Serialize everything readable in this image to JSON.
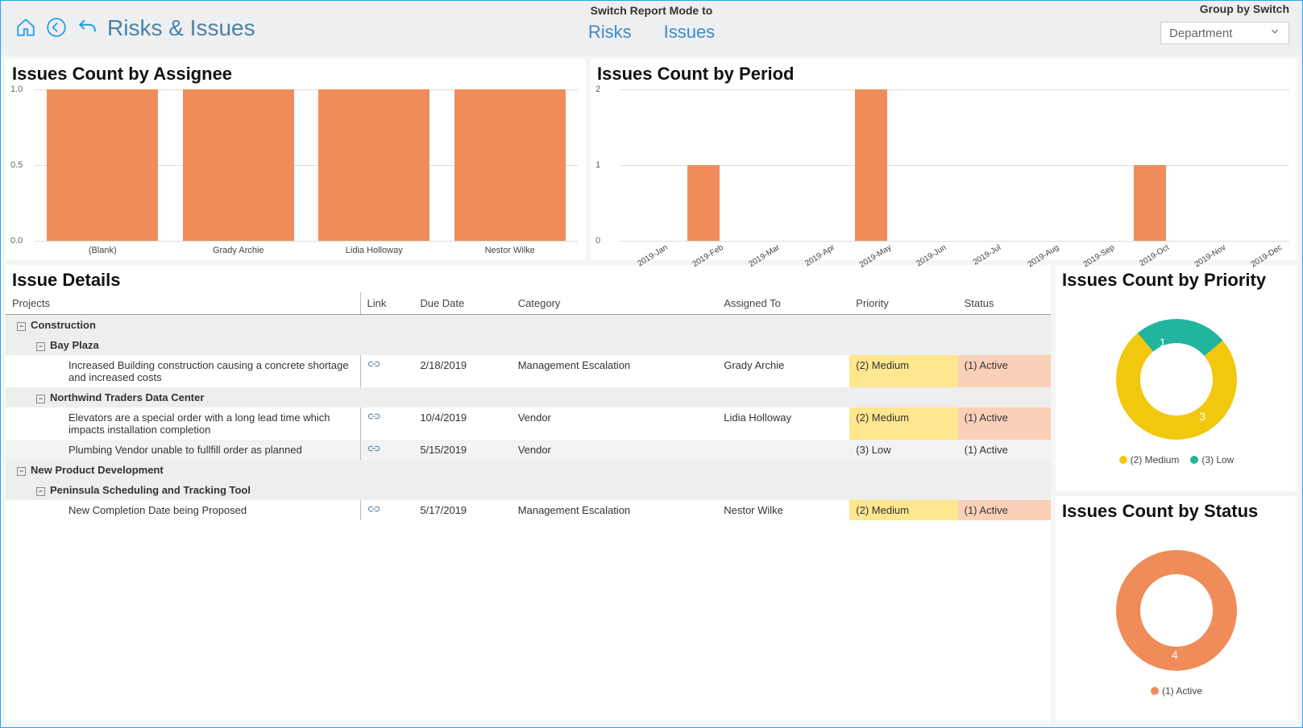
{
  "header": {
    "page_title": "Risks & Issues",
    "mode_label": "Switch Report Mode to",
    "tabs": [
      "Risks",
      "Issues"
    ],
    "groupby_label": "Group by Switch",
    "groupby_value": "Department"
  },
  "panel_assignee_title": "Issues Count by Assignee",
  "panel_period_title": "Issues Count by Period",
  "panel_details_title": "Issue Details",
  "panel_priority_title": "Issues Count by Priority",
  "panel_status_title": "Issues Count by Status",
  "details": {
    "columns": [
      "Projects",
      "Link",
      "Due Date",
      "Category",
      "Assigned To",
      "Priority",
      "Status"
    ],
    "groups": [
      {
        "name": "Construction",
        "subgroups": [
          {
            "name": "Bay Plaza",
            "rows": [
              {
                "desc": "Increased Building construction causing a concrete shortage and increased costs",
                "due": "2/18/2019",
                "category": "Management Escalation",
                "assigned": "Grady Archie",
                "priority": "(2) Medium",
                "priority_class": "medium",
                "status": "(1) Active"
              }
            ]
          },
          {
            "name": "Northwind Traders Data Center",
            "rows": [
              {
                "desc": "Elevators are a special order with a long lead time which impacts installation completion",
                "due": "10/4/2019",
                "category": "Vendor",
                "assigned": "Lidia Holloway",
                "priority": "(2) Medium",
                "priority_class": "medium",
                "status": "(1) Active"
              },
              {
                "desc": "Plumbing Vendor unable to fullfill order as planned",
                "due": "5/15/2019",
                "category": "Vendor",
                "assigned": "",
                "priority": "(3) Low",
                "priority_class": "low",
                "status": "(1) Active",
                "alt": true
              }
            ]
          }
        ]
      },
      {
        "name": "New Product Development",
        "subgroups": [
          {
            "name": "Peninsula Scheduling and Tracking Tool",
            "rows": [
              {
                "desc": "New Completion Date being Proposed",
                "due": "5/17/2019",
                "category": "Management Escalation",
                "assigned": "Nestor Wilke",
                "priority": "(2) Medium",
                "priority_class": "medium",
                "status": "(1) Active"
              }
            ]
          }
        ]
      }
    ]
  },
  "priority_legend": [
    "(2) Medium",
    "(3) Low"
  ],
  "priority_colors": [
    "#f2c80f",
    "#21b5a0"
  ],
  "priority_values": [
    3,
    1
  ],
  "status_legend": [
    "(1) Active"
  ],
  "status_colors": [
    "#f08c5a"
  ],
  "status_values": [
    4
  ],
  "chart_data": [
    {
      "type": "bar",
      "title": "Issues Count by Assignee",
      "categories": [
        "(Blank)",
        "Grady Archie",
        "Lidia Holloway",
        "Nestor Wilke"
      ],
      "values": [
        1,
        1,
        1,
        1
      ],
      "ylim": [
        0,
        1
      ],
      "yticks": [
        0.0,
        0.5,
        1.0
      ]
    },
    {
      "type": "bar",
      "title": "Issues Count by Period",
      "categories": [
        "2019-Jan",
        "2019-Feb",
        "2019-Mar",
        "2019-Apr",
        "2019-May",
        "2019-Jun",
        "2019-Jul",
        "2019-Aug",
        "2019-Sep",
        "2019-Oct",
        "2019-Nov",
        "2019-Dec"
      ],
      "values": [
        0,
        1,
        0,
        0,
        2,
        0,
        0,
        0,
        0,
        1,
        0,
        0
      ],
      "ylim": [
        0,
        2
      ],
      "yticks": [
        0,
        1,
        2
      ]
    },
    {
      "type": "pie",
      "title": "Issues Count by Priority",
      "series": [
        {
          "name": "(2) Medium",
          "value": 3,
          "color": "#f2c80f"
        },
        {
          "name": "(3) Low",
          "value": 1,
          "color": "#21b5a0"
        }
      ]
    },
    {
      "type": "pie",
      "title": "Issues Count by Status",
      "series": [
        {
          "name": "(1) Active",
          "value": 4,
          "color": "#f08c5a"
        }
      ]
    }
  ]
}
